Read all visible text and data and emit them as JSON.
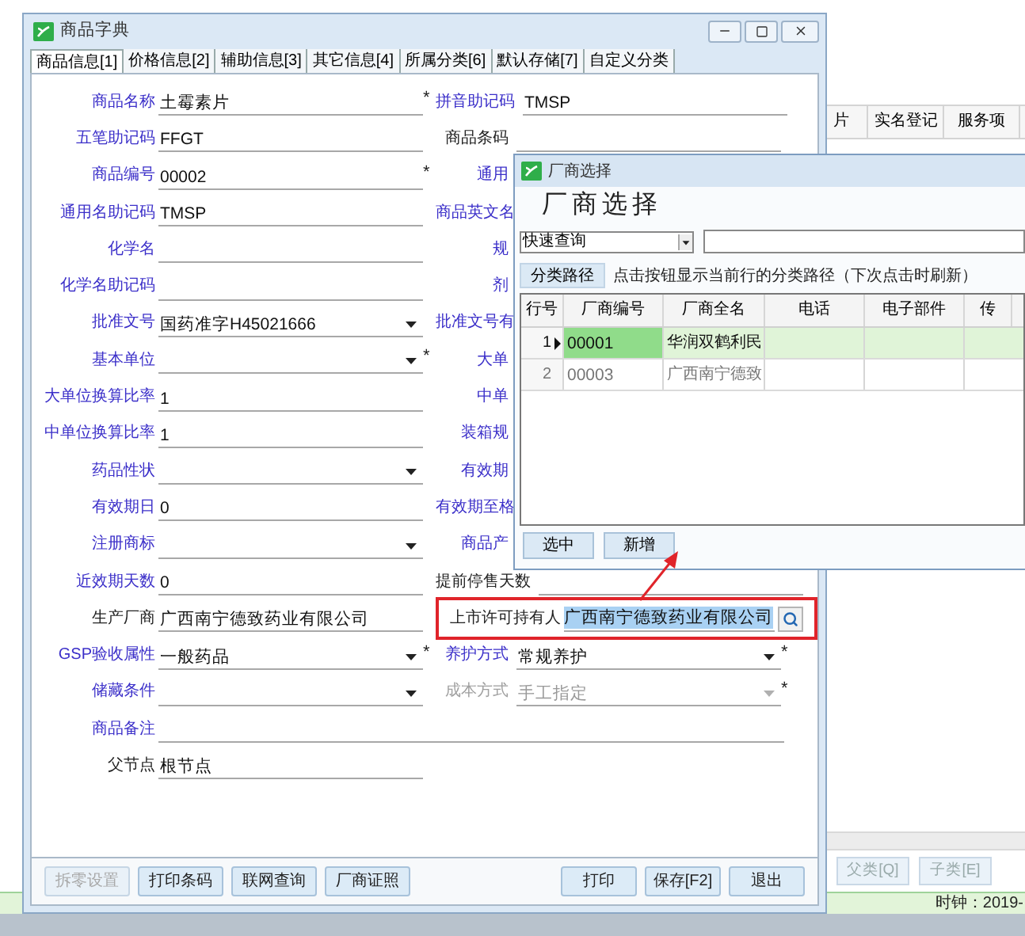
{
  "background_window": {
    "columns": [
      "片",
      "实名登记",
      "服务项"
    ],
    "buttons": [
      "父类[Q]",
      "子类[E]"
    ],
    "status_bar": "时钟：2019-"
  },
  "window": {
    "title": "商品字典"
  },
  "tabs": [
    {
      "label": "商品信息[1]",
      "selected": true
    },
    {
      "label": "价格信息[2]",
      "selected": false
    },
    {
      "label": "辅助信息[3]",
      "selected": false
    },
    {
      "label": "其它信息[4]",
      "selected": false
    },
    {
      "label": "所属分类[6]",
      "selected": false
    },
    {
      "label": "默认存储[7]",
      "selected": false
    },
    {
      "label": "自定义分类",
      "selected": false
    }
  ],
  "rows": [
    {
      "left": {
        "label": "商品名称",
        "linked": true,
        "kind": "text",
        "value": "土霉素片",
        "mark": "*"
      },
      "right": {
        "label": "拼音助记码",
        "linked": true,
        "disabled": false,
        "kind": "text",
        "value": "TMSP"
      }
    },
    {
      "left": {
        "label": "五笔助记码",
        "linked": true,
        "kind": "text",
        "value": "FFGT"
      },
      "right": {
        "label": "商品条码",
        "linked": false,
        "disabled": false,
        "kind": "text"
      }
    },
    {
      "left": {
        "label": "商品编号",
        "linked": true,
        "kind": "text",
        "value": "00002",
        "mark": "*"
      },
      "right": {
        "label": "通用",
        "linked": true,
        "disabled": false,
        "kind": "label"
      }
    },
    {
      "left": {
        "label": "通用名助记码",
        "linked": true,
        "kind": "text",
        "value": "TMSP"
      },
      "right": {
        "label": "商品英文名",
        "linked": true,
        "disabled": false,
        "kind": "label"
      }
    },
    {
      "left": {
        "label": "化学名",
        "linked": true,
        "kind": "text"
      },
      "right": {
        "label": "规",
        "linked": true,
        "disabled": false,
        "kind": "label"
      }
    },
    {
      "left": {
        "label": "化学名助记码",
        "linked": true,
        "kind": "text"
      },
      "right": {
        "label": "剂",
        "linked": true,
        "disabled": false,
        "kind": "label"
      }
    },
    {
      "left": {
        "label": "批准文号",
        "linked": true,
        "kind": "dropdown",
        "value": "国药准字H45021666"
      },
      "right": {
        "label": "批准文号有",
        "linked": true,
        "disabled": false,
        "kind": "label"
      }
    },
    {
      "left": {
        "label": "基本单位",
        "linked": true,
        "kind": "dropdown",
        "mark": "*"
      },
      "right": {
        "label": "大单",
        "linked": true,
        "disabled": false,
        "kind": "label"
      }
    },
    {
      "left": {
        "label": "大单位换算比率",
        "linked": true,
        "kind": "text",
        "value": "1"
      },
      "right": {
        "label": "中单",
        "linked": true,
        "disabled": false,
        "kind": "label"
      }
    },
    {
      "left": {
        "label": "中单位换算比率",
        "linked": true,
        "kind": "text",
        "value": "1"
      },
      "right": {
        "label": "装箱规",
        "linked": true,
        "disabled": false,
        "kind": "label"
      }
    },
    {
      "left": {
        "label": "药品性状",
        "linked": true,
        "kind": "dropdown"
      },
      "right": {
        "label": "有效期",
        "linked": true,
        "disabled": false,
        "kind": "label"
      }
    },
    {
      "left": {
        "label": "有效期日",
        "linked": true,
        "kind": "text",
        "value": "0"
      },
      "right": {
        "label": "有效期至格",
        "linked": true,
        "disabled": false,
        "kind": "label"
      }
    },
    {
      "left": {
        "label": "注册商标",
        "linked": true,
        "kind": "dropdown"
      },
      "right": {
        "label": "商品产",
        "linked": true,
        "disabled": false,
        "kind": "label"
      }
    },
    {
      "left": {
        "label": "近效期天数",
        "linked": true,
        "kind": "text",
        "value": "0"
      },
      "right": {
        "label": "提前停售天数",
        "linked": false,
        "disabled": false,
        "kind": "text"
      }
    },
    {
      "left": {
        "label": "生产厂商",
        "linked": false,
        "kind": "text",
        "value": "广西南宁德致药业有限公司"
      },
      "right": {
        "label": "上市许可持有人",
        "linked": false,
        "disabled": false,
        "kind": "lookup",
        "value": "广西南宁德致药业有限公司",
        "value_selected": true,
        "highlighted": true
      }
    },
    {
      "left": {
        "label": "GSP验收属性",
        "linked": true,
        "kind": "dropdown",
        "value": "一般药品",
        "mark": "*"
      },
      "right": {
        "label": "养护方式",
        "linked": true,
        "disabled": false,
        "kind": "dropdown",
        "value": "常规养护",
        "mark": "*"
      }
    },
    {
      "left": {
        "label": "储藏条件",
        "linked": true,
        "kind": "dropdown"
      },
      "right": {
        "label": "成本方式",
        "linked": false,
        "disabled": true,
        "kind": "dropdown",
        "value": "手工指定",
        "mark": "*"
      }
    },
    {
      "left": {
        "label": "商品备注",
        "linked": true,
        "kind": "wide"
      }
    },
    {
      "left": {
        "label": "父节点",
        "linked": false,
        "kind": "text",
        "value": "根节点"
      }
    }
  ],
  "footer_left": [
    {
      "label": "拆零设置",
      "disabled": true
    },
    {
      "label": "打印条码",
      "disabled": false
    },
    {
      "label": "联网查询",
      "disabled": false
    },
    {
      "label": "厂商证照",
      "disabled": false
    }
  ],
  "footer_right": [
    {
      "label": "打印",
      "disabled": false
    },
    {
      "label": "保存[F2]",
      "disabled": false
    },
    {
      "label": "退出",
      "disabled": false
    }
  ],
  "vendor_dialog": {
    "title": "厂商选择",
    "heading": "厂商选择",
    "query_mode": "快速查询",
    "path_button": "分类路径",
    "hint": "点击按钮显示当前行的分类路径（下次点击时刷新）",
    "columns": [
      "行号",
      "厂商编号",
      "厂商全名",
      "电话",
      "电子部件",
      "传"
    ],
    "rows": [
      {
        "index": "1",
        "code": "00001",
        "name": "华润双鹤利民",
        "selected": true
      },
      {
        "index": "2",
        "code": "00003",
        "name": "广西南宁德致",
        "selected": false
      }
    ],
    "buttons": [
      "选中",
      "新增"
    ]
  }
}
